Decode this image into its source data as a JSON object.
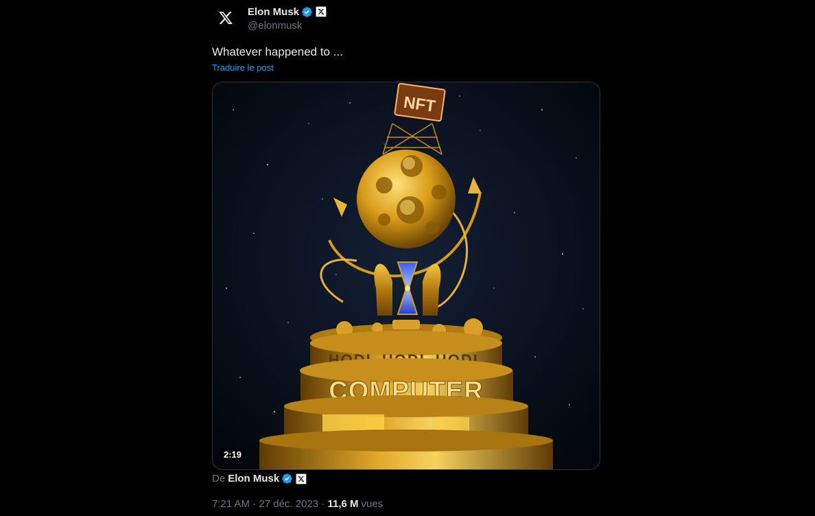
{
  "author": {
    "display_name": "Elon Musk",
    "handle": "@elonmusk",
    "avatar_icon": "x-logo-icon",
    "verified_icon": "verified-badge-icon",
    "affiliation_icon": "x-affiliation-icon"
  },
  "tweet": {
    "text": "Whatever happened to ...",
    "translate_label": "Traduire le post"
  },
  "media": {
    "duration": "2:19",
    "sign_text": "NFT",
    "ring_upper_text": "HODL HODL HODL",
    "ring_lower_text": "COMPUTER"
  },
  "attribution": {
    "prefix": "De",
    "name": "Elon Musk"
  },
  "meta": {
    "time": "7:21 AM",
    "separator1": " · ",
    "date": "27 déc. 2023",
    "separator2": " · ",
    "views_count": "11,6 M",
    "views_label": "vues"
  },
  "colors": {
    "accent": "#1d9bf0",
    "text_primary": "#e7e9ea",
    "text_secondary": "#71767b",
    "background": "#000000",
    "gold": "#d4a017"
  }
}
